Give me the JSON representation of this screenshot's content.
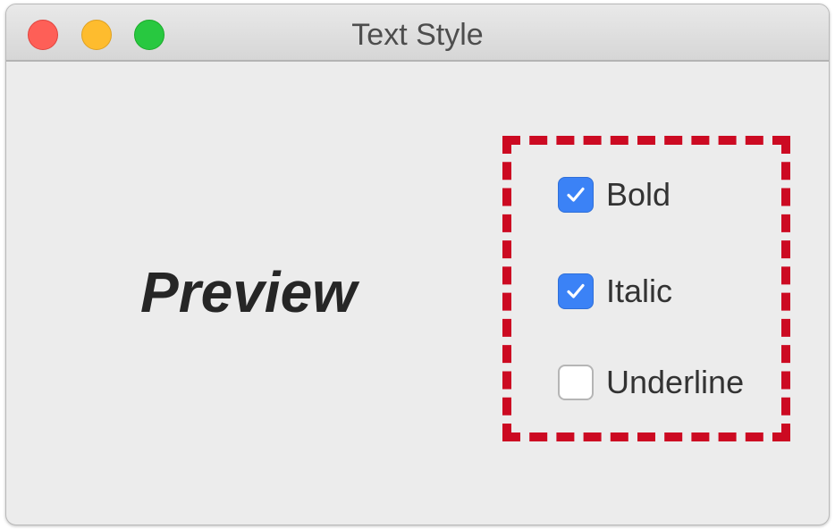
{
  "window": {
    "title": "Text Style",
    "controls": [
      "close",
      "minimize",
      "zoom"
    ]
  },
  "preview": {
    "text": "Preview",
    "bold": true,
    "italic": true,
    "underline": false
  },
  "checkboxes": [
    {
      "label": "Bold",
      "checked": true
    },
    {
      "label": "Italic",
      "checked": true
    },
    {
      "label": "Underline",
      "checked": false
    }
  ],
  "colors": {
    "checkbox_checked": "#3b82f6",
    "highlight_border": "#cc0a22",
    "traffic_close": "#fe5f57",
    "traffic_minimize": "#febc2e",
    "traffic_zoom": "#28c840"
  },
  "icons": {
    "checked": "checkmark-icon"
  }
}
